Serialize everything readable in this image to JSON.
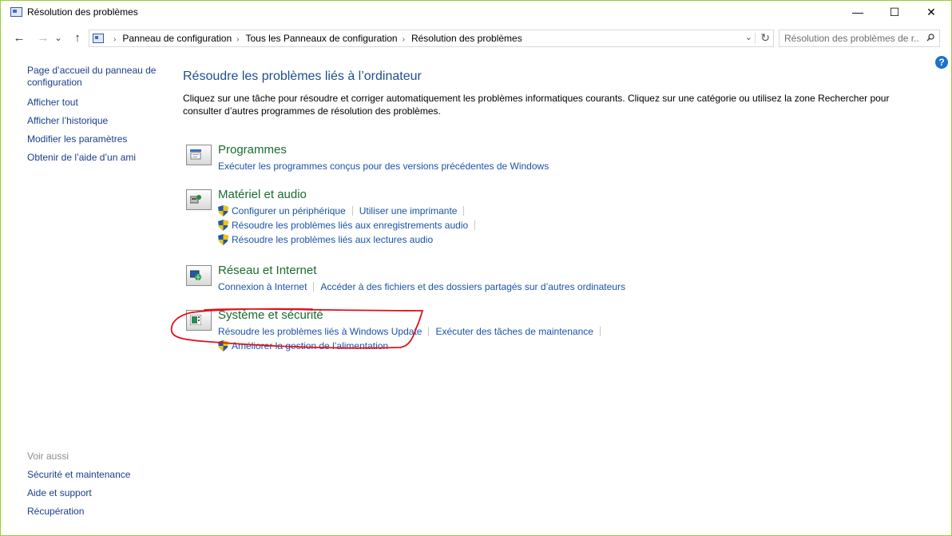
{
  "window": {
    "title": "Résolution des problèmes",
    "controls": {
      "minimize": "—",
      "maximize": "☐",
      "close": "✕"
    }
  },
  "nav": {
    "back": "←",
    "forward": "→",
    "recent": "⌄",
    "up": "↑",
    "breadcrumb": [
      "Panneau de configuration",
      "Tous les Panneaux de configuration",
      "Résolution des problèmes"
    ],
    "breadcrumb_sep": "›",
    "dropdown": "⌄",
    "refresh": "↻"
  },
  "search": {
    "placeholder": "Résolution des problèmes de r..."
  },
  "help": "?",
  "sidebar": {
    "links": [
      "Page d’accueil du panneau de configuration",
      "Afficher tout",
      "Afficher l’historique",
      "Modifier les paramètres",
      "Obtenir de l’aide d’un ami"
    ],
    "see_also_heading": "Voir aussi",
    "see_also": [
      "Sécurité et maintenance",
      "Aide et support",
      "Récupération"
    ]
  },
  "main": {
    "title": "Résoudre les problèmes liés à l’ordinateur",
    "description": "Cliquez sur une tâche pour résoudre et corriger automatiquement les problèmes informatiques courants. Cliquez sur une catégorie ou utilisez la zone Rechercher pour consulter d’autres programmes de résolution des problèmes.",
    "categories": [
      {
        "title": "Programmes",
        "icon": "programs-icon",
        "rows": [
          [
            {
              "label": "Exécuter les programmes conçus pour des versions précédentes de Windows",
              "shield": false
            }
          ]
        ]
      },
      {
        "title": "Matériel et audio",
        "icon": "hardware-sound-icon",
        "rows": [
          [
            {
              "label": "Configurer un périphérique",
              "shield": true
            },
            {
              "label": "Utiliser une imprimante",
              "shield": false
            }
          ],
          [
            {
              "label": "Résoudre les problèmes liés aux enregistrements audio",
              "shield": true
            }
          ],
          [
            {
              "label": "Résoudre les problèmes liés aux lectures audio",
              "shield": true
            }
          ]
        ]
      },
      {
        "title": "Réseau et Internet",
        "icon": "network-internet-icon",
        "rows": [
          [
            {
              "label": "Connexion à Internet",
              "shield": false
            },
            {
              "label": "Accéder à des fichiers et des dossiers partagés sur d’autres ordinateurs",
              "shield": false
            }
          ]
        ]
      },
      {
        "title": "Système et sécurité",
        "icon": "system-security-icon",
        "rows": [
          [
            {
              "label": "Résoudre les problèmes liés à Windows Update",
              "shield": false
            },
            {
              "label": "Exécuter des tâches de maintenance",
              "shield": false
            }
          ],
          [
            {
              "label": "Améliorer la gestion de l’alimentation",
              "shield": true
            }
          ]
        ]
      }
    ]
  },
  "colors": {
    "accent_border": "#9acd32",
    "link": "#1a52a8",
    "category_title": "#1a6b2e",
    "page_title": "#1e4e8c",
    "annotation": "#e0101a"
  }
}
